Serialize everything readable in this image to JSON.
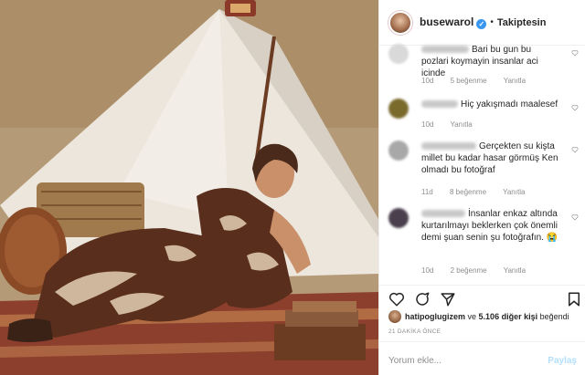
{
  "post": {
    "username": "busewarol",
    "verified_mark": "✓",
    "separator": "•",
    "follow_label": "Takiptesin"
  },
  "comments": [
    {
      "text": "Bari bu gun bu pozlari koymayin insanlar aci icinde",
      "age": "10d",
      "likes": "5 beğenme",
      "reply": "Yanıtla",
      "avatar_color": "#d9d9d9"
    },
    {
      "text": "Hiç yakışmadı maalesef",
      "age": "10d",
      "likes": "",
      "reply": "Yanıtla",
      "avatar_color": "#7a6a2c"
    },
    {
      "text": "Gerçekten su kiştа millet bu kadar hasar görmüş Ken olmadı bu fotoğraf",
      "age": "11d",
      "likes": "8 beğenme",
      "reply": "Yanıtla",
      "avatar_color": "#a8a8a8"
    },
    {
      "text": "İnsanlar enkaz altında kurtarılmayı beklerken çok önemli demi şuan senin şu fotoğrafın. 😭",
      "age": "10d",
      "likes": "2 beğenme",
      "reply": "Yanıtla",
      "avatar_color": "#4a3f4d"
    }
  ],
  "liked_by": {
    "user": "hatipoglugizem",
    "connector": "ve",
    "others": "5.106 diğer kişi",
    "suffix": "beğendi"
  },
  "timestamp": "21 DAKİKA ÖNCE",
  "comment_box": {
    "placeholder": "Yorum ekle...",
    "post_label": "Paylaş"
  },
  "icons": [
    "heart-icon",
    "comment-icon",
    "share-icon",
    "bookmark-icon",
    "verified-icon"
  ],
  "colors": {
    "link_blue": "#3897f0",
    "muted": "#8e8e8e",
    "border": "#efefef"
  }
}
